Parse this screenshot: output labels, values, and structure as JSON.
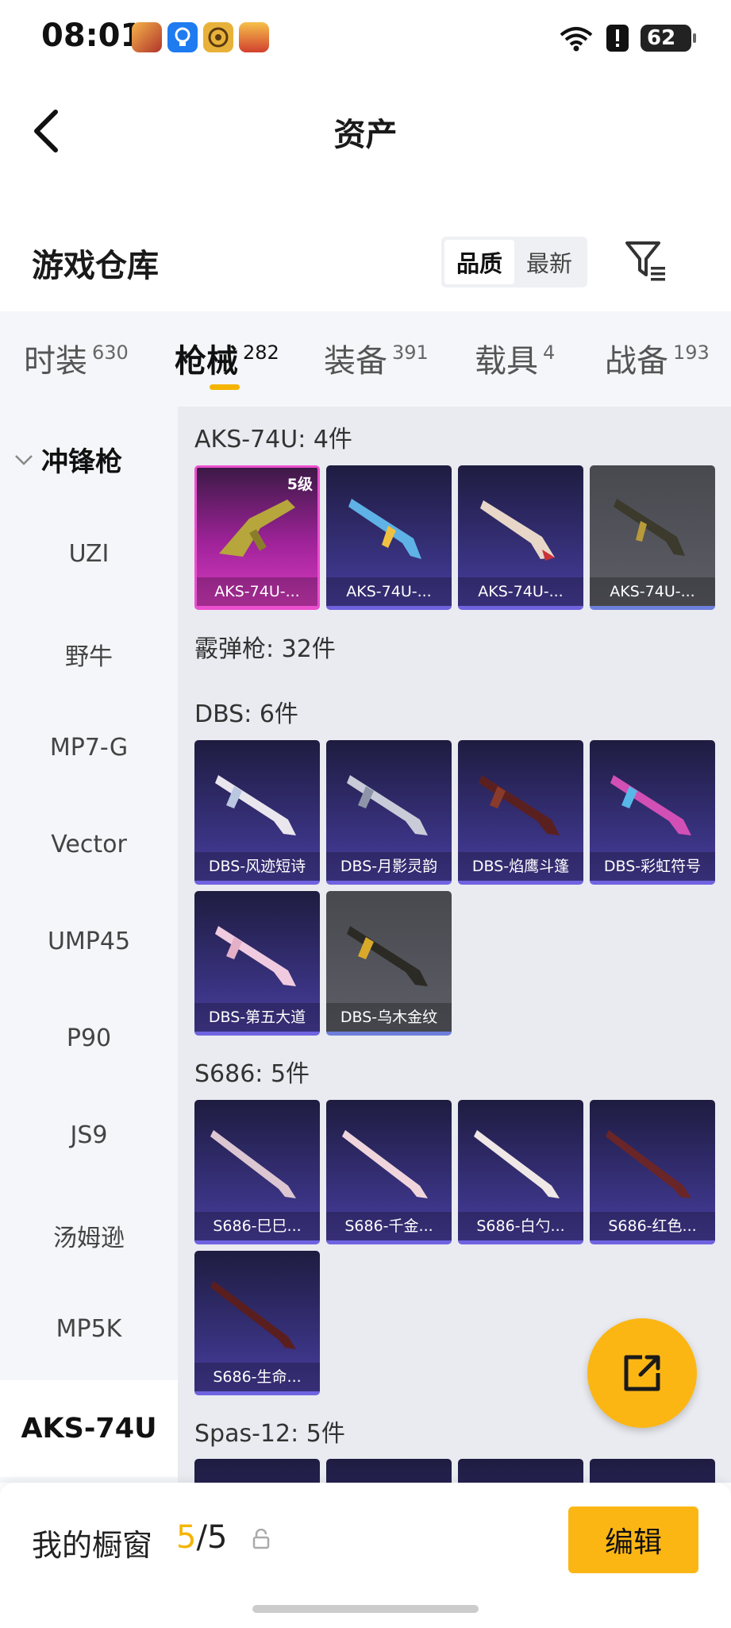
{
  "status_bar": {
    "time": "08:01",
    "battery": "62",
    "app_icons": [
      "hero-avatar-app-icon",
      "lightbulb-app-icon",
      "target-app-icon",
      "game-app-icon"
    ],
    "system_icons": [
      "wifi-6-icon",
      "alert-icon",
      "battery-icon"
    ]
  },
  "header": {
    "title": "资产",
    "back_icon": "chevron-left-icon"
  },
  "warehouse": {
    "title": "游戏仓库",
    "sort_options": [
      "品质",
      "最新"
    ],
    "sort_selected": "品质",
    "filter_icon": "filter-icon"
  },
  "tabs": [
    {
      "label": "时装",
      "count": "630"
    },
    {
      "label": "枪械",
      "count": "282"
    },
    {
      "label": "装备",
      "count": "391"
    },
    {
      "label": "载具",
      "count": "4"
    },
    {
      "label": "战备",
      "count": "193"
    }
  ],
  "active_tab": "枪械",
  "sidebar": {
    "category": "冲锋枪",
    "items": [
      "UZI",
      "野牛",
      "MP7-G",
      "Vector",
      "UMP45",
      "P90",
      "JS9",
      "汤姆逊",
      "MP5K",
      "AKS-74U"
    ],
    "selected": "AKS-74U"
  },
  "sections": [
    {
      "title": "AKS-74U: 4件",
      "items": [
        {
          "name": "AKS-74U-...",
          "rarity": "legendary",
          "badge": "5级"
        },
        {
          "name": "AKS-74U-...",
          "rarity": "epic"
        },
        {
          "name": "AKS-74U-...",
          "rarity": "epic"
        },
        {
          "name": "AKS-74U-...",
          "rarity": "common"
        }
      ]
    },
    {
      "title": "霰弹枪: 32件",
      "items": []
    },
    {
      "title": "DBS: 6件",
      "items": [
        {
          "name": "DBS-风迹短诗",
          "rarity": "epic"
        },
        {
          "name": "DBS-月影灵韵",
          "rarity": "epic"
        },
        {
          "name": "DBS-焰鹰斗篷",
          "rarity": "epic"
        },
        {
          "name": "DBS-彩虹符号",
          "rarity": "epic"
        },
        {
          "name": "DBS-第五大道",
          "rarity": "epic"
        },
        {
          "name": "DBS-乌木金纹",
          "rarity": "common"
        }
      ]
    },
    {
      "title": "S686: 5件",
      "items": [
        {
          "name": "S686-巳巳...",
          "rarity": "epic"
        },
        {
          "name": "S686-千金...",
          "rarity": "epic"
        },
        {
          "name": "S686-白勺...",
          "rarity": "epic"
        },
        {
          "name": "S686-红色...",
          "rarity": "epic"
        },
        {
          "name": "S686-生命...",
          "rarity": "epic"
        }
      ]
    },
    {
      "title": "Spas-12: 5件",
      "items": []
    }
  ],
  "fab_icon": "share-external-icon",
  "bottom_bar": {
    "label": "我的橱窗",
    "count_current": "5",
    "count_sep": "/",
    "count_total": "5",
    "lock_icon": "lock-icon",
    "edit_label": "编辑"
  },
  "colors": {
    "accent": "#FCB614",
    "rarity_epic": "#4A3F9F",
    "rarity_legendary": "#D93CC0",
    "rarity_common": "#5D5E66"
  }
}
